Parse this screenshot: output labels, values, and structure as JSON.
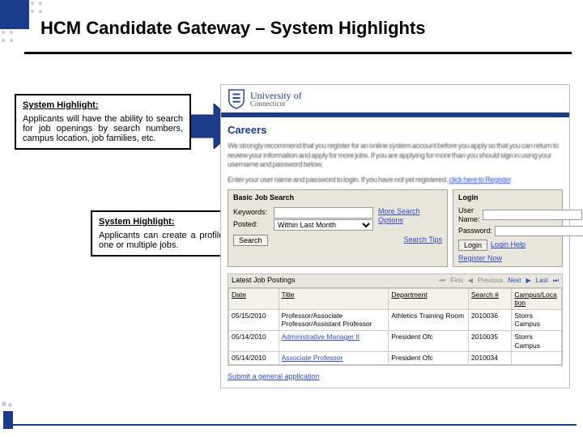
{
  "slide": {
    "title": "HCM Candidate Gateway – System Highlights"
  },
  "callout1": {
    "heading": "System Highlight:",
    "body": "Applicants will have the ability to search for job openings by search numbers, campus location, job families, etc."
  },
  "callout2": {
    "heading": "System Highlight:",
    "body": "Applicants can create a profile to be saved and used to apply for one or multiple jobs."
  },
  "screenshot": {
    "brand": {
      "line1": "University of",
      "line2": "Connecticut"
    },
    "careers_heading": "Careers",
    "intro_1": "We strongly recommend that you register for an online system account before you apply so that you can return to review your information and apply for more jobs. If you are applying for more than you should sign in using your username and password below.",
    "intro_2_pre": "Enter your user name and password to login. If you have not yet registered, ",
    "intro_2_link": "click here to Register",
    "search_panel": {
      "title": "Basic Job Search",
      "kw_label": "Keywords:",
      "posted_label": "Posted:",
      "posted_value": "Within Last Month",
      "more_label": "More Search Options",
      "search_btn": "Search",
      "tips_link": "Search Tips"
    },
    "login_panel": {
      "title": "Login",
      "user_label": "User Name:",
      "pass_label": "Password:",
      "login_btn": "Login",
      "help_link": "Login Help",
      "register_link": "Register Now"
    },
    "postings": {
      "title": "Latest Job Postings",
      "pager": {
        "first": "First",
        "prev": "Previous",
        "next": "Next",
        "last": "Last"
      },
      "columns": {
        "date": "Date",
        "title": "Title",
        "dept": "Department",
        "search": "Search #",
        "loc": "Campus/Location"
      },
      "rows": [
        {
          "date": "05/15/2010",
          "title": "Professor/Associate Professor/Assistant Professor",
          "title_link": false,
          "dept": "Athletics Training Room",
          "search": "2010036",
          "loc": "Storrs Campus"
        },
        {
          "date": "05/14/2010",
          "title": "Administrative Manager II",
          "title_link": true,
          "dept": "President Ofc",
          "search": "2010035",
          "loc": "Storrs Campus"
        },
        {
          "date": "05/14/2010",
          "title": "Associate Professor",
          "title_link": true,
          "dept": "President Ofc",
          "search": "2010034",
          "loc": ""
        }
      ]
    },
    "submit_link": "Submit a general application"
  }
}
